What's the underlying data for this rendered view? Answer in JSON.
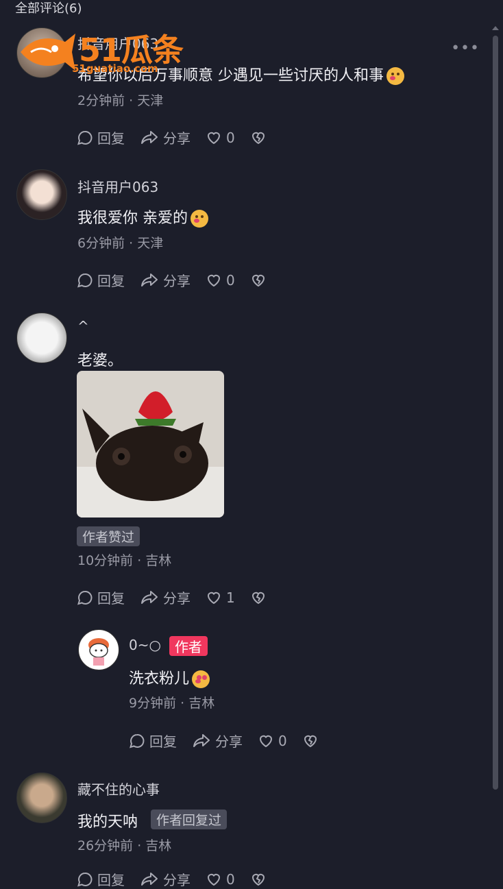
{
  "header": {
    "title": "全部评论(6)"
  },
  "watermark": {
    "brand": "51瓜条",
    "site": "51guatiao.com"
  },
  "comments": [
    {
      "username": "抖音用户063",
      "text": "希望你以后万事顺意 少遇见一些讨厌的人和事",
      "meta": "2分钟前 · 天津",
      "actions": {
        "reply": "回复",
        "share": "分享",
        "likes": "0"
      }
    },
    {
      "username": "抖音用户063",
      "text": "我很爱你 亲爱的",
      "meta": "6分钟前 · 天津",
      "actions": {
        "reply": "回复",
        "share": "分享",
        "likes": "0"
      }
    },
    {
      "username": "^",
      "text": "老婆。",
      "tag": "作者赞过",
      "meta": "10分钟前 · 吉林",
      "actions": {
        "reply": "回复",
        "share": "分享",
        "likes": "1"
      }
    },
    {
      "username": "藏不住的心事",
      "text": "我的天呐",
      "tag": "作者回复过",
      "meta": "26分钟前 · 吉林",
      "actions": {
        "reply": "回复",
        "share": "分享",
        "likes": "0"
      }
    }
  ],
  "reply": {
    "username": "0~○",
    "author_badge": "作者",
    "text": "洗衣粉儿",
    "meta": "9分钟前 · 吉林",
    "actions": {
      "reply": "回复",
      "share": "分享",
      "likes": "0"
    }
  },
  "colors": {
    "background": "#1c1e2a",
    "author_badge": "#f0375e",
    "watermark": "#f4811f"
  },
  "icons": [
    "more-icon",
    "reply-icon",
    "share-icon",
    "heart-icon",
    "dislike-icon"
  ]
}
